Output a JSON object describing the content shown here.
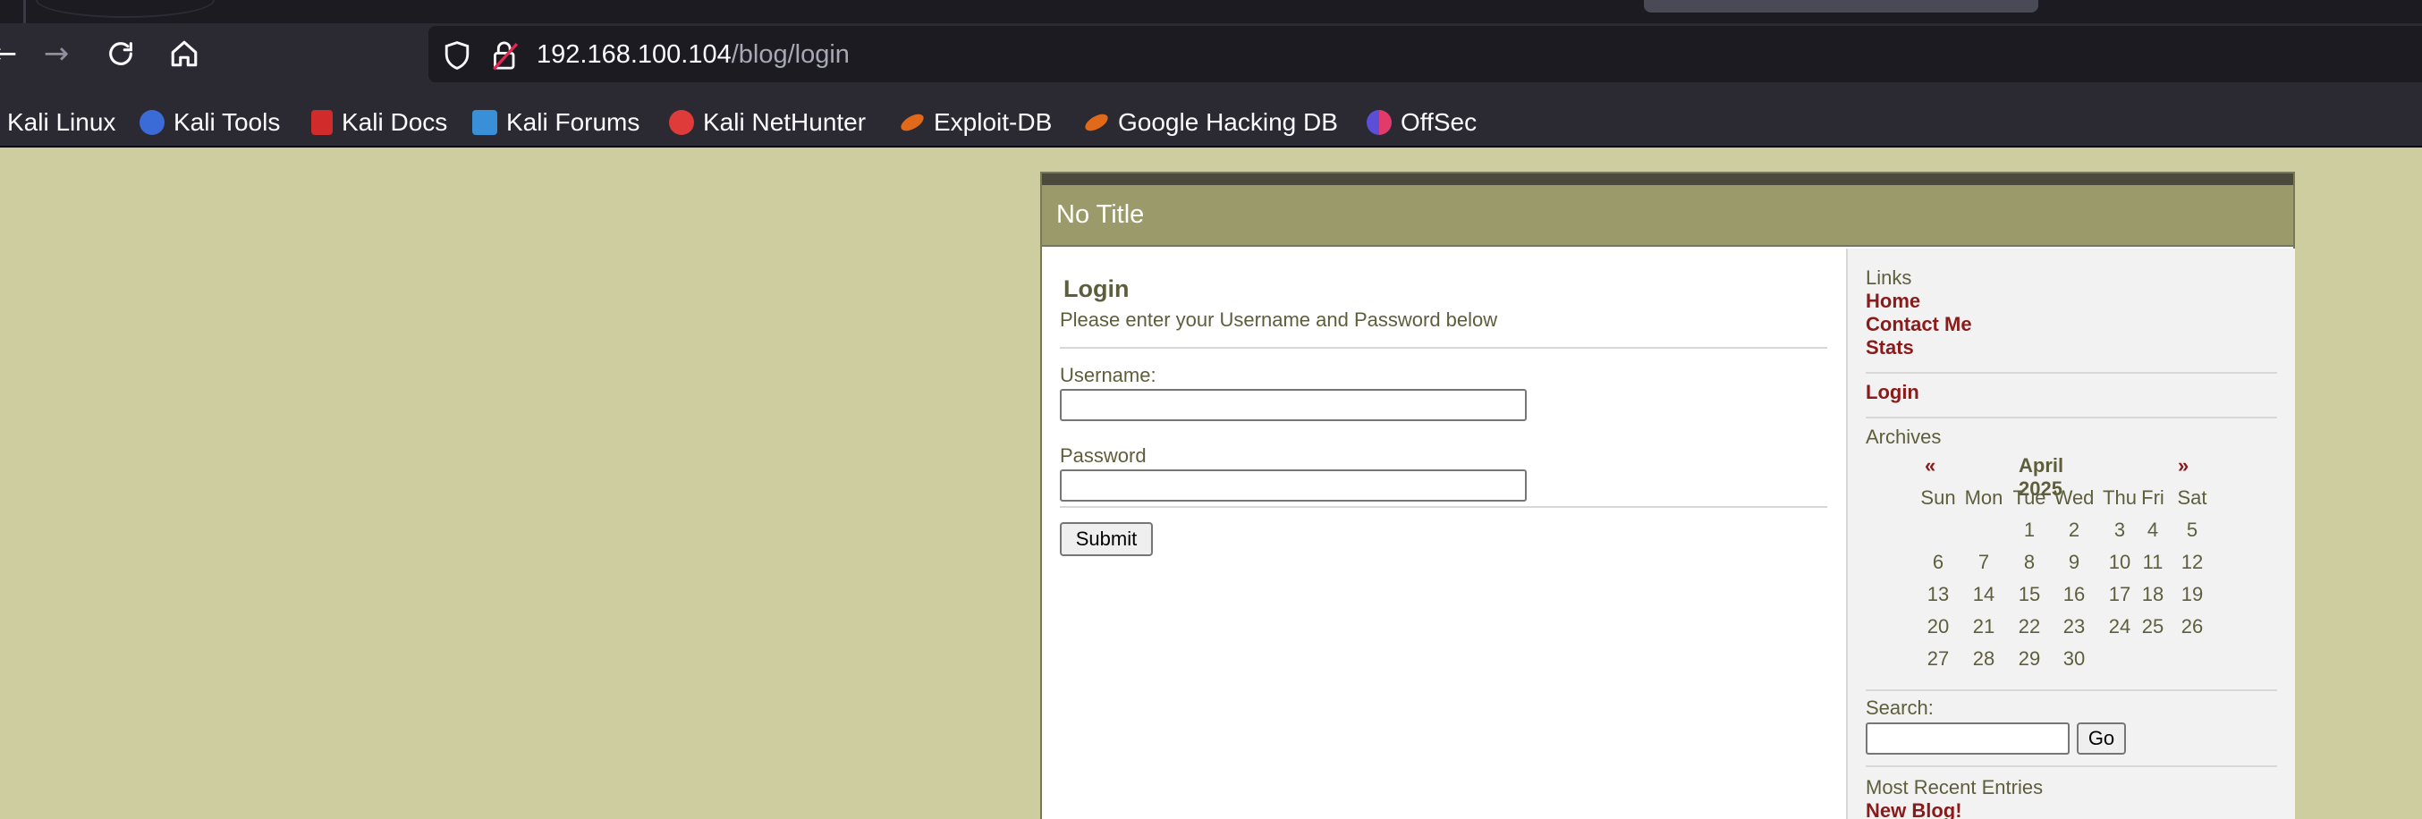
{
  "browser": {
    "url_host": "192.168.100.104",
    "url_path": "/blog/login",
    "bookmarks": [
      {
        "label": "Kali Linux",
        "icon": "kali-linux-icon",
        "color": "#2b2a33"
      },
      {
        "label": "Kali Tools",
        "icon": "kali-tools-icon",
        "color": "#3b6bd6"
      },
      {
        "label": "Kali Docs",
        "icon": "kali-docs-icon",
        "color": "#d22b2b"
      },
      {
        "label": "Kali Forums",
        "icon": "kali-forums-icon",
        "color": "#3a8fd9"
      },
      {
        "label": "Kali NetHunter",
        "icon": "kali-nethunter-icon",
        "color": "#e03b3b"
      },
      {
        "label": "Exploit-DB",
        "icon": "exploit-db-icon",
        "color": "#e06a1a"
      },
      {
        "label": "Google Hacking DB",
        "icon": "google-hacking-db-icon",
        "color": "#e06a1a"
      },
      {
        "label": "OffSec",
        "icon": "offsec-icon",
        "color": "#5a4fd6"
      }
    ]
  },
  "site": {
    "title": "No Title"
  },
  "login": {
    "heading": "Login",
    "subtitle": "Please enter your Username and Password below",
    "username_label": "Username:",
    "username_value": "",
    "password_label": "Password",
    "password_value": "",
    "submit_label": "Submit"
  },
  "sidebar": {
    "links_title": "Links",
    "links": [
      "Home",
      "Contact Me",
      "Stats"
    ],
    "login_link": "Login",
    "archives_title": "Archives",
    "calendar": {
      "prev": "«",
      "month": "April 2025",
      "next": "»",
      "weekdays": [
        "Sun",
        "Mon",
        "Tue",
        "Wed",
        "Thu",
        "Fri",
        "Sat"
      ],
      "weeks": [
        [
          "",
          "",
          "1",
          "2",
          "3",
          "4",
          "5"
        ],
        [
          "6",
          "7",
          "8",
          "9",
          "10",
          "11",
          "12"
        ],
        [
          "13",
          "14",
          "15",
          "16",
          "17",
          "18",
          "19"
        ],
        [
          "20",
          "21",
          "22",
          "23",
          "24",
          "25",
          "26"
        ],
        [
          "27",
          "28",
          "29",
          "30",
          "",
          "",
          ""
        ]
      ]
    },
    "search_label": "Search:",
    "search_value": "",
    "go_label": "Go",
    "recent_title": "Most Recent Entries",
    "recent_entry": "New Blog!"
  }
}
